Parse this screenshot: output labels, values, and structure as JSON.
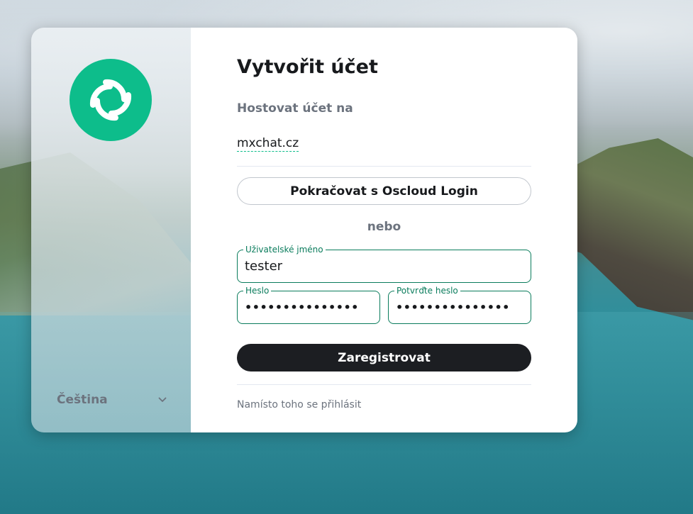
{
  "colors": {
    "accent": "#0dbd8b",
    "field_border": "#0a7c5c",
    "primary_button": "#1c1e22",
    "muted_text": "#6c737e"
  },
  "sidebar": {
    "logo_icon": "element-logo-icon",
    "language": {
      "label": "Čeština",
      "icon": "chevron-down-icon"
    }
  },
  "form": {
    "title": "Vytvořit účet",
    "host_label": "Hostovat účet na",
    "server_name": "mxchat.cz",
    "sso_button_label": "Pokračovat s Oscloud Login",
    "or_text": "nebo",
    "username": {
      "label": "Uživatelské jméno",
      "value": "tester"
    },
    "password": {
      "label": "Heslo",
      "value": "•••••••••••••••"
    },
    "confirm_password": {
      "label": "Potvrďte heslo",
      "value": "•••••••••••••••"
    },
    "register_button_label": "Zaregistrovat",
    "signin_link": "Namísto toho se přihlásit"
  }
}
